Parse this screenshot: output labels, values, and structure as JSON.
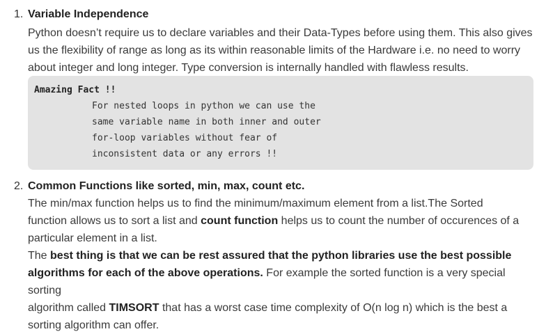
{
  "item1": {
    "number": "1.",
    "title": "Variable Independence",
    "lines": [
      "Python doesn’t require us to declare variables and their Data-Types before using them. This also gives",
      "us the flexibility of range as long as its within reasonable limits of the Hardware i.e. no need to worry",
      "about integer and long integer. Type conversion is internally handled with flawless results."
    ],
    "code_title": "Amazing Fact !!",
    "code_lines": [
      "For nested loops in python we can use the",
      "same variable name in both inner and outer",
      "for-loop variables without fear of",
      "inconsistent data or any errors !!"
    ]
  },
  "item2": {
    "number": "2.",
    "title": "Common Functions like sorted, min, max, count etc.",
    "p1_line1": "The min/max function helps us to find the minimum/maximum element from a list.The Sorted",
    "p1_line2_pre": "function allows us to sort a list and ",
    "p1_line2_bold": "count function",
    "p1_line2_post": " helps us to count the number of occurences of a",
    "p1_line3": "particular element in a list.",
    "p2_line1_pre": "The ",
    "p2_line1_bold": "best thing is that we can be rest assured that the python libraries use the best possible",
    "p2_line2_bold": "algorithms for each of the above operations.",
    "p2_line2_post": " For example the sorted function is a very special sorting",
    "p2_line3_pre": "algorithm called ",
    "p2_line3_bold": "TIMSORT",
    "p2_line3_post": " that has a worst case time complexity of O(n log n) which is the best a",
    "p2_line4": "sorting algorithm can offer."
  }
}
